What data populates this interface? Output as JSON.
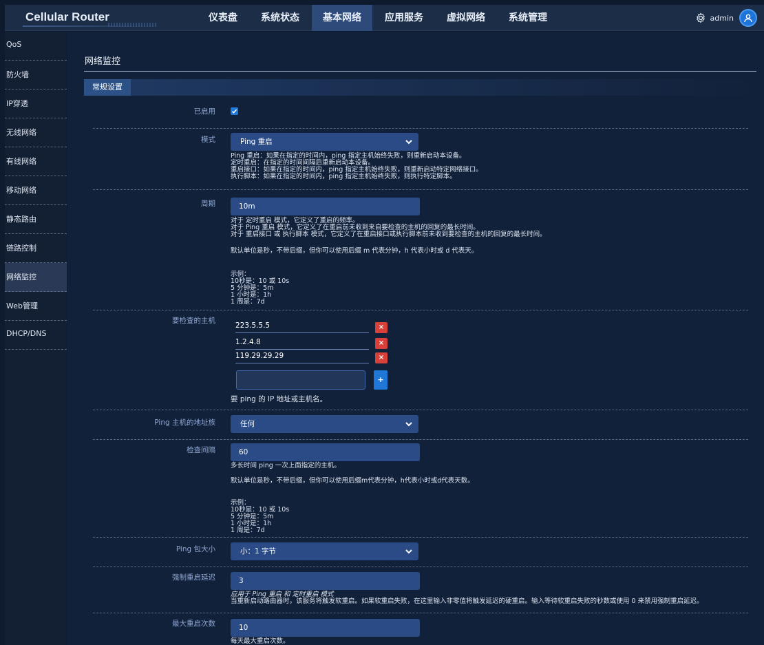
{
  "app": {
    "brand": "Cellular Router",
    "username": "admin"
  },
  "nav": [
    "仪表盘",
    "系统状态",
    "基本网络",
    "应用服务",
    "虚拟网络",
    "系统管理"
  ],
  "sidebar": [
    "QoS",
    "防火墙",
    "IP穿透",
    "无线网络",
    "有线网络",
    "移动网络",
    "静态路由",
    "链路控制",
    "网络监控",
    "Web管理",
    "DHCP/DNS"
  ],
  "page": {
    "title": "网络监控",
    "tab": "常规设置"
  },
  "form": {
    "enabled_label": "已启用",
    "mode": {
      "label": "模式",
      "value": "Ping 重启",
      "desc": [
        "Ping 重启：如果在指定的时间内，ping 指定主机始终失败，则重新启动本设备。",
        "定时重启：在指定的时间间隔后重新启动本设备。",
        "重启接口：如果在指定的时间内，ping 指定主机始终失败，则重新启动特定网络接口。",
        "执行脚本：如果在指定的时间内，ping 指定主机始终失败，则执行特定脚本。"
      ]
    },
    "period": {
      "label": "周期",
      "value": "10m",
      "desc": [
        "对于 定时重启 模式，它定义了重启的频率。",
        "对于 Ping 重启 模式，它定义了在重启前未收到来自要检查的主机的回复的最长时间。",
        "对于 重启接口 或 执行脚本 模式，它定义了在重启接口或执行脚本前未收到要检查的主机的回复的最长时间。",
        "",
        "默认单位是秒，不带后缀，但你可以使用后缀 m 代表分钟，h 代表小时或 d 代表天。",
        "",
        "",
        "示例：",
        "10秒是：10 或 10s",
        "5 分钟是：5m",
        "1 小时是：1h",
        "1 周是：7d"
      ]
    },
    "hosts": {
      "label": "要检查的主机",
      "items": [
        "223.5.5.5",
        "1.2.4.8",
        "119.29.29.29"
      ],
      "delete_label": "×",
      "add_label": "+",
      "hint": "要 ping 的 IP 地址或主机名。"
    },
    "family": {
      "label": "Ping 主机的地址族",
      "value": "任何"
    },
    "interval": {
      "label": "检查间隔",
      "value": "60",
      "desc": [
        "多长时间 ping 一次上面指定的主机。",
        "",
        "默认单位是秒，不带后缀，但你可以使用后缀m代表分钟，h代表小时或d代表天数。",
        "",
        "",
        "示例：",
        "10秒是：10 或 10s",
        "5 分钟是：5m",
        "1 小时是：1h",
        "1 周是：7d"
      ]
    },
    "pingsize": {
      "label": "Ping 包大小",
      "value": "小：1 字节"
    },
    "forcedelay": {
      "label": "强制重启延迟",
      "value": "3",
      "desc": [
        "应用于 Ping 重启 和 定时重启 模式",
        "当重新启动路由器时，该服务将触发软重启。如果软重启失败，在这里输入非零值将触发延迟的硬重启。输入等待软重启失败的秒数或使用 0 来禁用强制重启延迟。"
      ]
    },
    "maxreboot": {
      "label": "最大重启次数",
      "value": "10",
      "desc": "每天最大重启次数。"
    }
  }
}
